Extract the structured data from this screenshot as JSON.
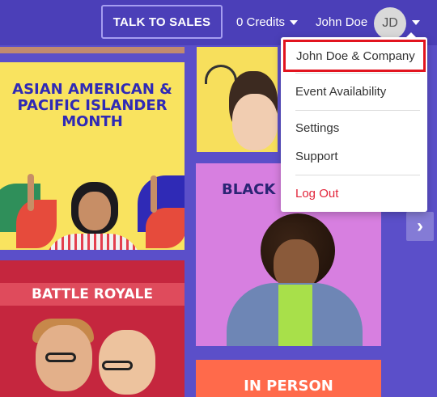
{
  "header": {
    "talk_to_sales": "TALK TO SALES",
    "credits": "0 Credits",
    "user_name": "John Doe",
    "avatar_initials": "JD"
  },
  "menu": {
    "company": "John Doe & Company",
    "event_availability": "Event Availability",
    "settings": "Settings",
    "support": "Support",
    "logout": "Log Out"
  },
  "cards": {
    "aapi_title": "ASIAN AMERICAN & PACIFIC ISLANDER MONTH",
    "black_title": "BLACK EX",
    "battle_title": "BATTLE ROYALE",
    "in_person_title": "IN PERSON"
  },
  "colors": {
    "background": "#5b4fc9",
    "header": "#4b3fb8",
    "logout_red": "#e2243a",
    "highlight_border": "#e2141f"
  },
  "icons": {
    "credits_dropdown": "chevron-down-icon",
    "user_dropdown": "chevron-down-icon",
    "carousel_next": "chevron-right-icon"
  }
}
